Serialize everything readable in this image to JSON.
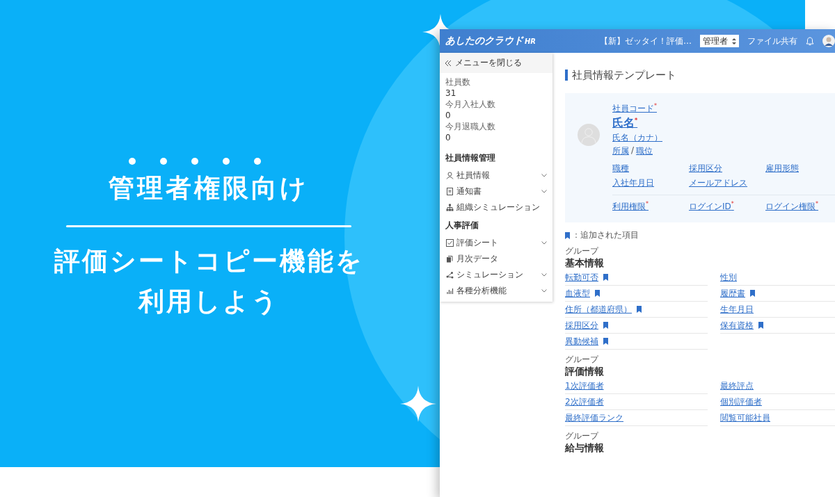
{
  "banner": {
    "headline": "管理者権限向け",
    "subtitle_lines": [
      "評価シートコピー機能を",
      "利用しよう"
    ]
  },
  "app": {
    "header": {
      "logo": "あしたのクラウド",
      "logo_suffix": "HR",
      "notice": "【新】ゼッタイ！評価…",
      "role_select": "管理者",
      "file_share": "ファイル共有"
    },
    "sidebar": {
      "close_menu": "メニューを閉じる",
      "stats": [
        {
          "label": "社員数",
          "value": "31"
        },
        {
          "label": "今月入社人数",
          "value": "0"
        },
        {
          "label": "今月退職人数",
          "value": "0"
        }
      ],
      "sections": [
        {
          "title": "社員情報管理",
          "items": [
            {
              "label": "社員情報",
              "expandable": true
            },
            {
              "label": "通知書",
              "expandable": true
            },
            {
              "label": "組織シミュレーション",
              "expandable": false
            }
          ]
        },
        {
          "title": "人事評価",
          "items": [
            {
              "label": "評価シート",
              "expandable": true
            },
            {
              "label": "月次データ",
              "expandable": false
            },
            {
              "label": "シミュレーション",
              "expandable": true
            },
            {
              "label": "各種分析機能",
              "expandable": true
            }
          ]
        }
      ]
    },
    "page_title": "社員情報テンプレート",
    "profile": {
      "code": {
        "label": "社員コード",
        "mark": "*"
      },
      "name": {
        "label": "氏名",
        "mark": "*"
      },
      "kana": {
        "label": "氏名（カナ）"
      },
      "affiliation": "所属",
      "separator": "/",
      "position": "職位",
      "grid": [
        {
          "label": "職種"
        },
        {
          "label": "採用区分"
        },
        {
          "label": "雇用形態"
        },
        {
          "label": "入社年月日"
        },
        {
          "label": "メールアドレス"
        }
      ],
      "access": [
        {
          "label": "利用権限",
          "mark": "*"
        },
        {
          "label": "ログインID",
          "mark": "*"
        },
        {
          "label": "ログイン権限",
          "mark": "*"
        }
      ]
    },
    "legend": "：追加された項目",
    "groups": [
      {
        "caption": "グループ",
        "title": "基本情報",
        "fields": [
          {
            "label": "転勤可否",
            "added": true
          },
          {
            "label": "性別",
            "added": false
          },
          {
            "label": "血液型",
            "added": true
          },
          {
            "label": "履歴書",
            "added": true
          },
          {
            "label": "住所（都道府県）",
            "added": true
          },
          {
            "label": "生年月日",
            "added": false
          },
          {
            "label": "採用区分",
            "added": true
          },
          {
            "label": "保有資格",
            "added": true
          },
          {
            "label": "異動候補",
            "added": true
          }
        ]
      },
      {
        "caption": "グループ",
        "title": "評価情報",
        "fields": [
          {
            "label": "1次評価者",
            "added": false
          },
          {
            "label": "最終評点",
            "added": false
          },
          {
            "label": "2次評価者",
            "added": false
          },
          {
            "label": "個別評価者",
            "added": false
          },
          {
            "label": "最終評価ランク",
            "added": false
          },
          {
            "label": "閲覧可能社員",
            "added": false
          }
        ]
      },
      {
        "caption": "グループ",
        "title": "給与情報"
      }
    ]
  }
}
